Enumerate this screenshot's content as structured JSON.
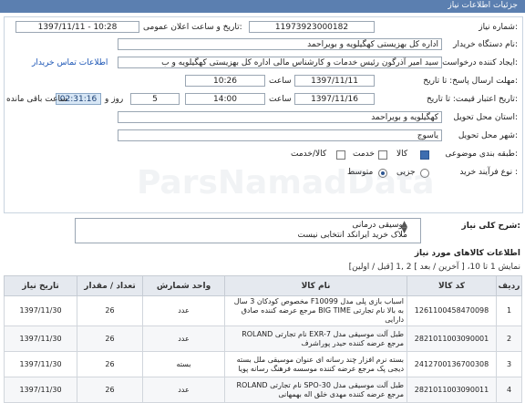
{
  "header": {
    "title": "جزئیات اطلاعات نیاز"
  },
  "form": {
    "need_number_label": "شماره نیاز:",
    "need_number": "11973923000182",
    "announce_label": "تاریخ و ساعت اعلان عمومی:",
    "announce_value": "1397/11/11 - 10:28",
    "buyer_label": "نام دستگاه خریدار:",
    "buyer_value": "اداره کل بهزیستی کهگیلویه و بویراحمد",
    "creator_label": "ایجاد کننده درخواست:",
    "creator_value": "سید امیر آذرگون رئیس خدمات و کارشناس مالی اداره کل بهزیستی کهگیلویه و ب",
    "contact_link": "اطلاعات تماس خریدار",
    "response_deadline_label": "مهلت ارسال پاسخ: تا تاریخ:",
    "response_date": "1397/11/11",
    "time_label": "ساعت",
    "response_time": "10:26",
    "validity_label": "تاریخ اعتبار قیمت: تا تاریخ:",
    "validity_date": "1397/11/16",
    "validity_time": "14:00",
    "days_value": "5",
    "days_label": "روز و",
    "timer_value": "02:31:16",
    "remaining_label": "ساعت باقی مانده",
    "province_label": "استان محل تحویل:",
    "province_value": "کهگیلویه و بویراحمد",
    "city_label": "شهر محل تحویل:",
    "city_value": "یاسوج",
    "category_label": "طبقه بندی موضوعی:",
    "category_options": [
      "کالا",
      "خدمت",
      "کالا/خدمت"
    ],
    "process_label": "نوع فرآیند خرید :",
    "process_options": [
      "جزیی",
      "متوسط"
    ],
    "general_desc_label": "شرح کلی نیاز:",
    "general_desc_lines": [
      "موسیقی درمانی",
      "ملاک خرید ایرانکد انتخابی نیست"
    ],
    "watermark": "ParsNamadData"
  },
  "goods": {
    "section_title": "اطلاعات کالاهای مورد نیاز",
    "pagination": "نمایش 1 تا 10، [ آخرین / بعد ] 2 ,1 [قبل / اولین]",
    "columns": [
      "ردیف",
      "کد کالا",
      "نام کالا",
      "واحد شمارش",
      "تعداد / مقدار",
      "تاریخ نیاز"
    ],
    "rows": [
      {
        "row": "1",
        "code": "1261100458470098",
        "name": "اسباب بازی پلی مدل F10099 مخصوص کودکان 3 سال به بالا نام تجارتی BIG TIME مرجع عرضه کننده صادق دارایی",
        "unit": "عدد",
        "qty": "26",
        "date": "1397/11/30"
      },
      {
        "row": "2",
        "code": "2821011003090001",
        "name": "طبل آلت موسیقی مدل EXR-7 نام تجارتی ROLAND مرجع عرضه کننده حیدر پوراشرف",
        "unit": "عدد",
        "qty": "26",
        "date": "1397/11/30"
      },
      {
        "row": "3",
        "code": "2412700136700308",
        "name": "بسته نرم افزار چند رسانه ای عنوان موسیقی ملل بسته دیجی پک مرجع عرضه کننده موسسه فرهنگ رسانه پویا",
        "unit": "بسته",
        "qty": "26",
        "date": "1397/11/30"
      },
      {
        "row": "4",
        "code": "2821011003090011",
        "name": "طبل آلت موسیقی مدل SPO-30 نام تجارتی ROLAND مرجع عرضه کننده مهدی خلق اله بهمهانی",
        "unit": "عدد",
        "qty": "26",
        "date": "1397/11/30"
      }
    ]
  }
}
